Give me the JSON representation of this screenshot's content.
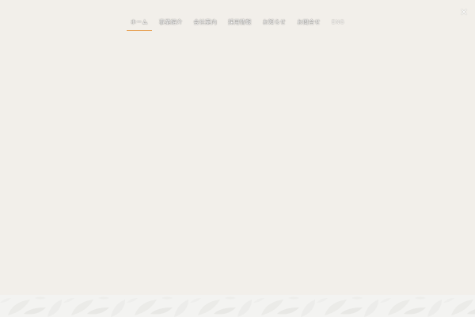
{
  "nav": {
    "items": [
      {
        "label": "ホーム",
        "active": true
      },
      {
        "label": "事業紹介",
        "active": false
      },
      {
        "label": "会社案内",
        "active": false
      },
      {
        "label": "採用情報",
        "active": false
      },
      {
        "label": "お知らせ",
        "active": false
      },
      {
        "label": "お問合せ",
        "active": false
      },
      {
        "label": "ENG",
        "active": false
      }
    ]
  },
  "header": {
    "corner_icon": "close-icon"
  },
  "footer": {
    "pattern_icon": "leaf-pattern"
  },
  "colors": {
    "background": "#f2efea",
    "active_underline": "#e8a55c",
    "footer_band": "#f3f3f1"
  }
}
